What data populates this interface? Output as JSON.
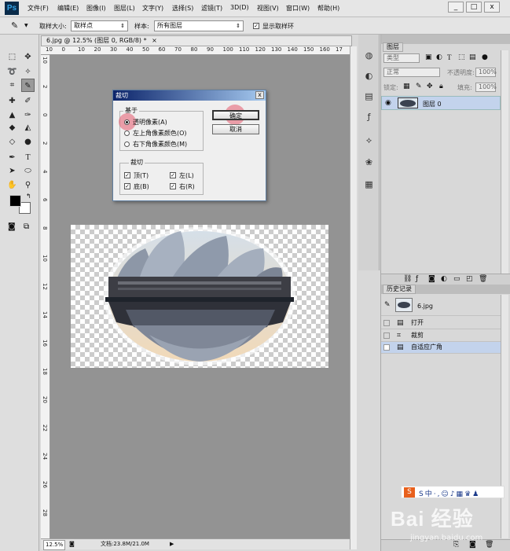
{
  "app": {
    "logo": "Ps"
  },
  "menu": [
    "文件(F)",
    "编辑(E)",
    "图像(I)",
    "图层(L)",
    "文字(Y)",
    "选择(S)",
    "滤镜(T)",
    "3D(D)",
    "视图(V)",
    "窗口(W)",
    "帮助(H)"
  ],
  "window_buttons": [
    "_",
    "□",
    "x"
  ],
  "options": {
    "sample_size_label": "取样大小:",
    "sample_size_value": "取样点",
    "sample_label": "样本:",
    "sample_value": "所有图层",
    "show_ring_label": "显示取样环"
  },
  "document": {
    "tab_title": "6.jpg @ 12.5% (图层 0, RGB/8) *",
    "tab_close": "×",
    "ruler_top": [
      "10",
      "0",
      "10",
      "20",
      "30",
      "40",
      "50",
      "60",
      "70",
      "80",
      "90",
      "100",
      "110",
      "120",
      "130",
      "140",
      "150",
      "160",
      "17"
    ],
    "ruler_left": [
      "10",
      "2",
      "0",
      "2",
      "4",
      "6",
      "8",
      "10",
      "12",
      "14",
      "16",
      "18",
      "20",
      "22",
      "24",
      "26",
      "28"
    ],
    "zoom": "12.5%",
    "doc_info": "文档:23.8M/21.0M"
  },
  "dialog": {
    "title": "裁切",
    "close": "x",
    "group1_title": "基于",
    "radio_transparent": "透明像素(A)",
    "radio_topleft": "左上角像素颜色(O)",
    "radio_bottomright": "右下角像素颜色(M)",
    "group2_title": "裁切",
    "cb_top": "顶(T)",
    "cb_left": "左(L)",
    "cb_bottom": "底(B)",
    "cb_right": "右(R)",
    "ok": "确定",
    "cancel": "取消",
    "check_mark": "✓"
  },
  "layers": {
    "tab": "图层",
    "filter_value": "类型",
    "blend_value": "正常",
    "opacity_label": "不透明度:",
    "opacity_value": "100%",
    "lock_label": "锁定:",
    "fill_label": "填充:",
    "fill_value": "100%",
    "layer_name": "图层 0"
  },
  "history": {
    "tab": "历史记录",
    "snapshot": "6.jpg",
    "items": [
      "打开",
      "裁剪",
      "自适应广角"
    ]
  },
  "watermark": {
    "main": "Bai 经验",
    "sub": "jingyan.baidu.com",
    "ime": "S中·,☺♪▦♛♟"
  },
  "colors": {
    "accent": "#0c246a",
    "selected_row": "#c3d3ec",
    "highlight": "#e65a6e"
  }
}
